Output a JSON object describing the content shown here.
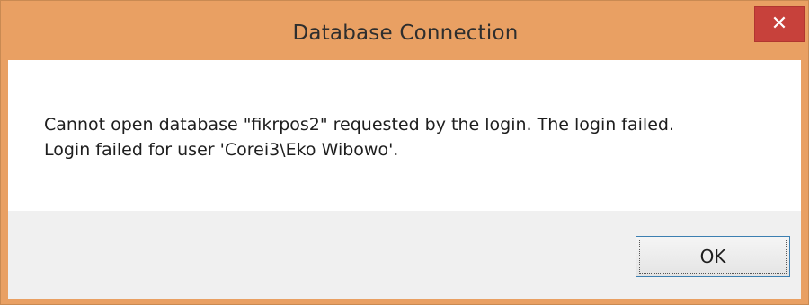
{
  "window": {
    "title": "Database Connection",
    "close_icon": "close-icon",
    "close_glyph": "✕",
    "titlebar_color": "#e9a063",
    "close_color": "#c7413b"
  },
  "message": {
    "line1": "Cannot open database \"fikrpos2\" requested by the login. The login failed.",
    "line2": "Login failed for user 'Corei3\\Eko Wibowo'."
  },
  "buttons": {
    "ok_label": "OK"
  }
}
